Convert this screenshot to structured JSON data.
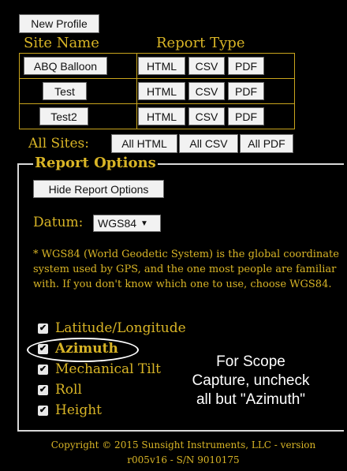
{
  "toolbar": {
    "new_profile_label": "New Profile"
  },
  "table": {
    "site_header": "Site Name",
    "report_header": "Report Type",
    "rows": [
      {
        "site": "ABQ Balloon",
        "html": "HTML",
        "csv": "CSV",
        "pdf": "PDF"
      },
      {
        "site": "Test",
        "html": "HTML",
        "csv": "CSV",
        "pdf": "PDF"
      },
      {
        "site": "Test2",
        "html": "HTML",
        "csv": "CSV",
        "pdf": "PDF"
      }
    ]
  },
  "all_sites": {
    "label": "All Sites:",
    "html_label": "All HTML",
    "csv_label": "All CSV",
    "pdf_label": "All PDF"
  },
  "report_options": {
    "title": "Report Options",
    "hide_label": "Hide Report Options",
    "datum_label": "Datum:",
    "datum_value": "WGS84",
    "note": "* WGS84 (World Geodetic System) is the global coordinate system used by GPS, and the one most people are familiar with. If you don't know which one to use, choose WGS84.",
    "options": [
      {
        "label": "Latitude/Longitude",
        "checked": true
      },
      {
        "label": "Azimuth",
        "checked": true
      },
      {
        "label": "Mechanical Tilt",
        "checked": true
      },
      {
        "label": "Roll",
        "checked": true
      },
      {
        "label": "Height",
        "checked": true
      }
    ]
  },
  "annotation": {
    "line1": "For Scope",
    "line2": "Capture, uncheck",
    "line3": "all but \"Azimuth\""
  },
  "footer": {
    "line1": "Copyright © 2015 Sunsight Instruments, LLC - version",
    "line2": "r005v16 - S/N 9010175"
  },
  "colors": {
    "accent": "#d9b526",
    "background": "#000000",
    "button": "#f2f2f2"
  }
}
